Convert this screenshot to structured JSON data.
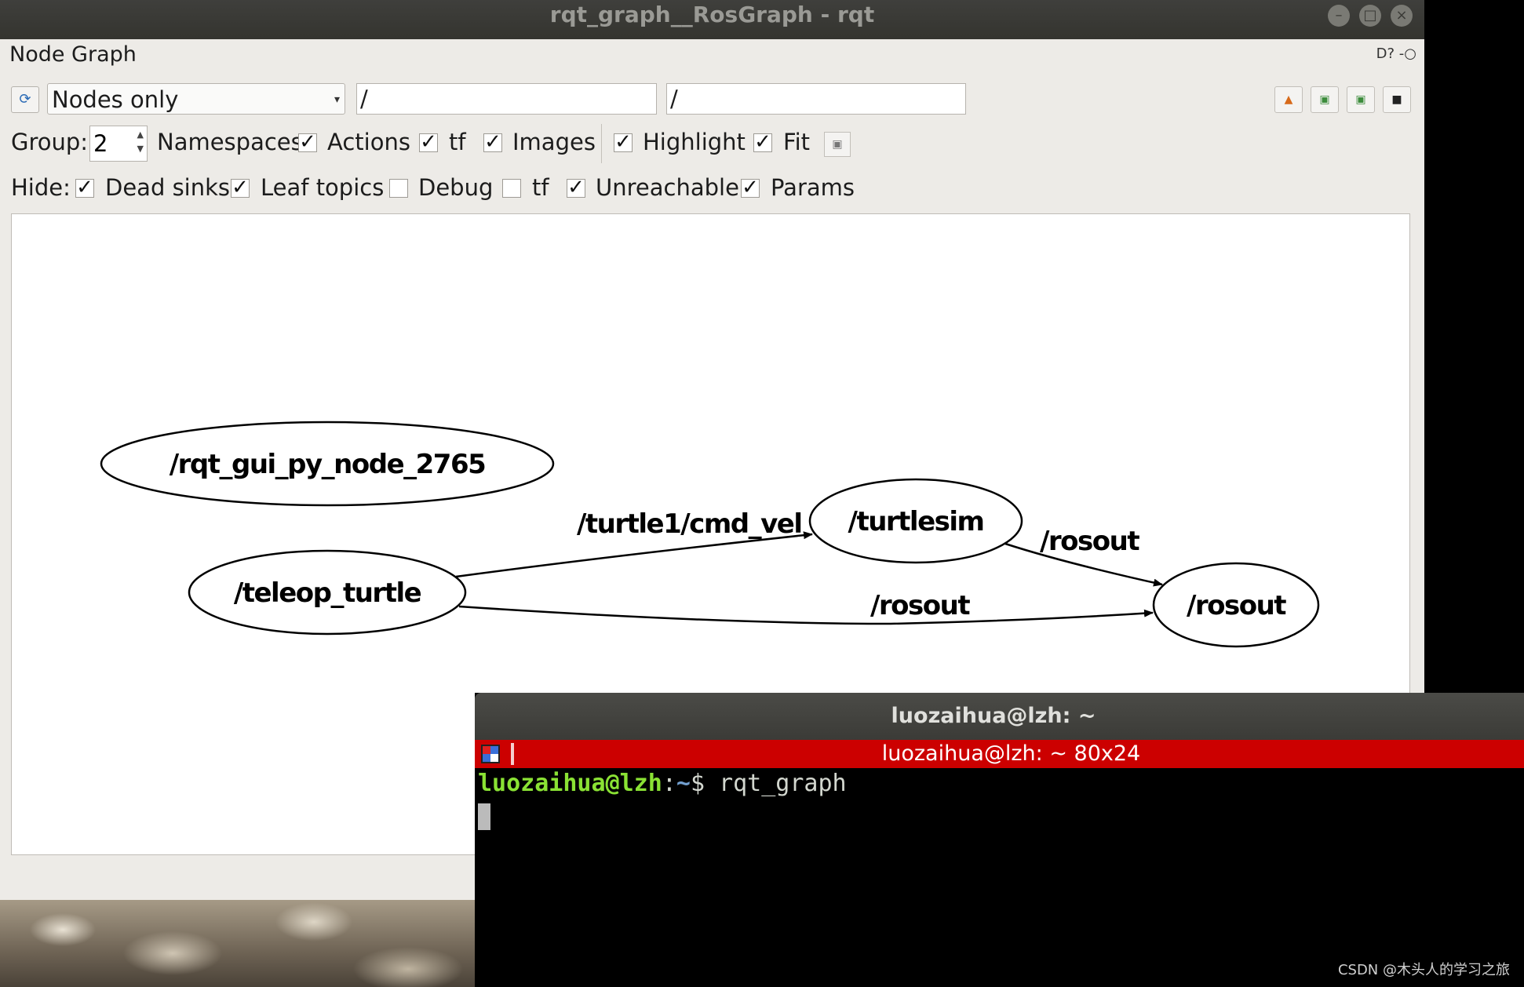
{
  "window": {
    "title": "rqt_graph__RosGraph - rqt",
    "plugin_title": "Node Graph",
    "plugin_icons": "D?  -○"
  },
  "toolbar": {
    "refresh_icon": "refresh-icon",
    "mode": "Nodes only",
    "node_filter": "/",
    "topic_filter": "/"
  },
  "group_row": {
    "group_label": "Group:",
    "group_value": "2",
    "namespaces_label": "Namespaces",
    "namespaces_checked": true,
    "actions_label": "Actions",
    "actions_checked": true,
    "tf_label": "tf",
    "tf_checked": true,
    "images_label": "Images",
    "images_checked": true,
    "highlight_label": "Highlight",
    "highlight_checked": true,
    "fit_label": "Fit",
    "fit_checked": true
  },
  "hide_row": {
    "hide_label": "Hide:",
    "dead_sinks_label": "Dead sinks",
    "dead_sinks_checked": true,
    "leaf_topics_label": "Leaf topics",
    "leaf_topics_checked": true,
    "debug_label": "Debug",
    "debug_checked": false,
    "tf_label": "tf",
    "tf_checked": false,
    "unreachable_label": "Unreachable",
    "unreachable_checked": true,
    "params_label": "Params",
    "params_checked": true
  },
  "graph": {
    "nodes": [
      {
        "id": "rqt",
        "label": "/rqt_gui_py_node_2765"
      },
      {
        "id": "teleop",
        "label": "/teleop_turtle"
      },
      {
        "id": "turtlesim",
        "label": "/turtlesim"
      },
      {
        "id": "rosout",
        "label": "/rosout"
      }
    ],
    "edges": [
      {
        "from": "teleop",
        "to": "turtlesim",
        "label": "/turtle1/cmd_vel"
      },
      {
        "from": "turtlesim",
        "to": "rosout",
        "label": "/rosout"
      },
      {
        "from": "teleop",
        "to": "rosout",
        "label": "/rosout"
      }
    ]
  },
  "terminal": {
    "title": "luozaihua@lzh: ~",
    "tab_title": "luozaihua@lzh: ~ 80x24",
    "prompt_user": "luozaihua@lzh",
    "prompt_sep": ":",
    "prompt_path": "~",
    "prompt_symbol": "$",
    "command": "rqt_graph"
  },
  "watermark": "CSDN @木头人的学习之旅"
}
